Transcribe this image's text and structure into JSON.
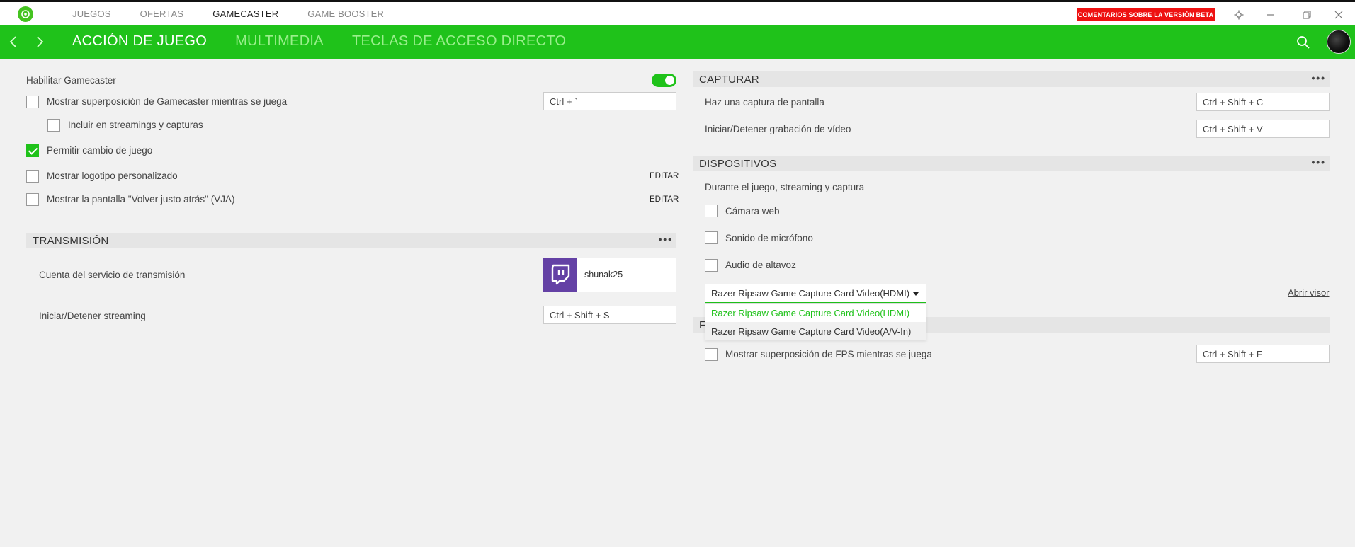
{
  "topnav": {
    "items": [
      "JUEGOS",
      "OFERTAS",
      "GAMECASTER",
      "GAME BOOSTER"
    ],
    "active": "GAMECASTER",
    "beta_button": "COMENTARIOS SOBRE LA VERSIÓN BETA"
  },
  "tabs": {
    "items": [
      "ACCIÓN DE JUEGO",
      "MULTIMEDIA",
      "TECLAS DE ACCESO DIRECTO"
    ],
    "active": "ACCIÓN DE JUEGO"
  },
  "left": {
    "enable_gamecaster": {
      "label": "Habilitar Gamecaster",
      "value": "on"
    },
    "overlay": {
      "label": "Mostrar superposición de Gamecaster mientras se juega",
      "hotkey": "Ctrl + `",
      "checked": false
    },
    "include_streams": {
      "label": "Incluir en streamings y capturas",
      "checked": false
    },
    "allow_game_switch": {
      "label": "Permitir cambio de juego",
      "checked": true
    },
    "custom_logo": {
      "label": "Mostrar logotipo personalizado",
      "checked": false,
      "edit": "EDITAR"
    },
    "vja": {
      "label": "Mostrar la pantalla \"Volver justo atrás\" (VJA)",
      "checked": false,
      "edit": "EDITAR"
    },
    "transmission": {
      "title": "TRANSMISIÓN",
      "account_label": "Cuenta del servicio de transmisión",
      "account_name": "shunak25",
      "stream_label": "Iniciar/Detener streaming",
      "stream_hotkey": "Ctrl + Shift + S"
    }
  },
  "right": {
    "capture": {
      "title": "CAPTURAR",
      "screenshot_label": "Haz una captura de pantalla",
      "screenshot_hotkey": "Ctrl + Shift + C",
      "record_label": "Iniciar/Detener grabación de vídeo",
      "record_hotkey": "Ctrl + Shift + V"
    },
    "devices": {
      "title": "DISPOSITIVOS",
      "subtitle": "Durante el juego, streaming y captura",
      "webcam": "Cámara web",
      "mic": "Sonido de micrófono",
      "speaker": "Audio de altavoz",
      "selected_device": "Razer Ripsaw Game Capture Card Video(HDMI)",
      "options": [
        "Razer Ripsaw Game Capture Card Video(HDMI)",
        "Razer Ripsaw Game Capture Card Video(A/V-In)"
      ],
      "open_viewer": "Abrir visor"
    },
    "fps": {
      "title_visible": "F",
      "label": "Mostrar superposición de FPS mientras se juega",
      "hotkey": "Ctrl + Shift + F"
    }
  },
  "colors": {
    "accent": "#1fc21a",
    "beta": "#ee1111",
    "twitch": "#6441a5"
  }
}
